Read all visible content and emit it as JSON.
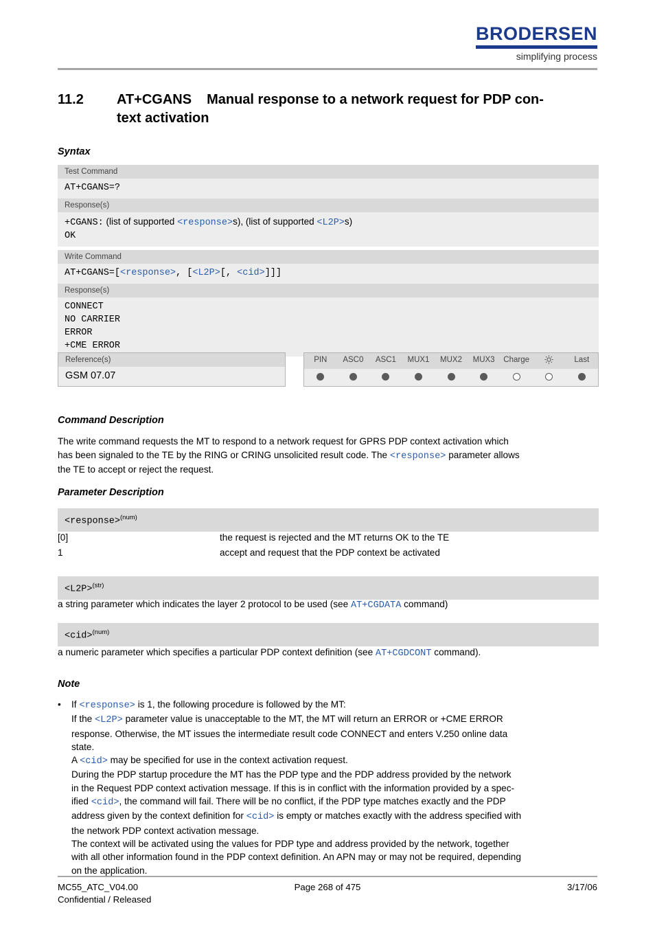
{
  "header": {
    "brand_name": "BRODERSEN",
    "brand_tagline": "simplifying process"
  },
  "title": {
    "number": "11.2",
    "command": "AT+CGANS",
    "line1": "Manual response to a network request for PDP con-",
    "line2": "text activation"
  },
  "sections": {
    "syntax": "Syntax",
    "command_description": "Command Description",
    "parameter_description": "Parameter Description",
    "note": "Note"
  },
  "syntax": {
    "test_command_label": "Test Command",
    "test_command": "AT+CGANS=?",
    "test_response_label": "Response(s)",
    "test_response_prefix": "+CGANS:",
    "test_response_text1": "(list of supported",
    "test_response_param1": "<response>",
    "test_response_text2": "s), (list of supported",
    "test_response_param2": "<L2P>",
    "test_response_text3": "s)",
    "test_response_ok": "OK",
    "write_command_label": "Write Command",
    "write_command_prefix": "AT+CGANS=[",
    "write_command_p1": "<response>",
    "write_command_sep1": ", ",
    "write_command_p2": "<L2P>",
    "write_command_sep2": "[, ",
    "write_command_p3": "<cid>",
    "write_command_suffix": "]]]",
    "write_command_bracket": "[",
    "write_response_label": "Response(s)",
    "write_responses": [
      "CONNECT",
      "NO CARRIER",
      "ERROR",
      "+CME ERROR"
    ],
    "reference_label": "Reference(s)",
    "reference_value": "GSM 07.07",
    "columns": [
      "PIN",
      "ASC0",
      "ASC1",
      "MUX1",
      "MUX2",
      "MUX3",
      "Charge",
      "sun-icon",
      "Last"
    ],
    "dots": [
      "filled",
      "filled",
      "filled",
      "filled",
      "filled",
      "filled",
      "open",
      "open",
      "filled"
    ]
  },
  "command_description": {
    "line1_a": "The write command requests the MT to respond to a network request for GPRS PDP context activation which",
    "line2_a": "has been signaled to the TE by the RING or CRING unsolicited result code. The ",
    "line2_param": "<response>",
    "line2_b": " parameter allows",
    "line3": "the TE to accept or reject the request."
  },
  "parameters": [
    {
      "name": "<response>",
      "type": "(num)",
      "rows": [
        {
          "key": "[0]",
          "desc": "the request is rejected and the MT returns OK to the TE"
        },
        {
          "key": "1",
          "desc": "accept and request that the PDP context be activated"
        }
      ]
    },
    {
      "name": "<L2P>",
      "type": "(str)",
      "text_a": "a string parameter which indicates the layer 2 protocol to be used (see ",
      "text_link": "AT+CGDATA",
      "text_b": " command)"
    },
    {
      "name": "<cid>",
      "type": "(num)",
      "text_a": "a numeric parameter which specifies a particular PDP context definition (see ",
      "text_link": "AT+CGDCONT",
      "text_b": " command)."
    }
  ],
  "note": {
    "bullet": "•",
    "l1_a": "If ",
    "l1_param": "<response>",
    "l1_b": " is 1, the following procedure is followed by the MT:",
    "l2_a": "If the ",
    "l2_param": "<L2P>",
    "l2_b": " parameter value is unacceptable to the MT, the MT will return an ERROR or +CME ERROR",
    "l3": "response. Otherwise, the MT issues the intermediate result code CONNECT and enters V.250 online data",
    "l4": "state.",
    "l5_a": "A ",
    "l5_param": "<cid>",
    "l5_b": " may be specified for use in the context activation request.",
    "l6": "During the PDP startup procedure the MT has the PDP type and the PDP address provided by the network",
    "l7": "in the Request PDP context activation message. If this is in conflict with the information provided by a spec-",
    "l8_a": "ified ",
    "l8_param": "<cid>",
    "l8_b": ", the command will fail. There will be no conflict, if the PDP type matches exactly and the PDP",
    "l9_a": "address given by the context definition for ",
    "l9_param": "<cid>",
    "l9_b": " is empty or matches exactly with the address specified with",
    "l10": "the network PDP context activation message.",
    "l11": "The context will be activated using the values for PDP type and address provided by the network, together",
    "l12": "with all other information found in the PDP context definition. An APN may or may not be required, depending",
    "l13": "on the application."
  },
  "footer": {
    "left_top": "MC55_ATC_V04.00",
    "left_bottom": "Confidential / Released",
    "center": "Page 268 of 475",
    "right": "3/17/06"
  },
  "colors": {
    "brand_blue": "#1b3a8c",
    "param_blue": "#2a5caa",
    "band_dark": "#d9d9d9",
    "band_light": "#ededed",
    "rule_gray": "#a6a6a6"
  }
}
